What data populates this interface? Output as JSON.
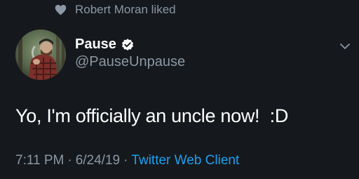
{
  "social_context": {
    "text": "Robert Moran liked",
    "icon": "heart-icon"
  },
  "author": {
    "display_name": "Pause",
    "handle": "@PauseUnpause",
    "verified": true,
    "avatar_icon": "avatar"
  },
  "tweet": {
    "text": "Yo, I'm officially an uncle now!  :D"
  },
  "meta": {
    "time": "7:11 PM",
    "separator": "·",
    "date": "6/24/19",
    "client": "Twitter Web Client"
  },
  "colors": {
    "background": "#15181c",
    "primary_text": "#ffffff",
    "secondary_text": "#8b98a5",
    "link": "#1da1f2"
  }
}
